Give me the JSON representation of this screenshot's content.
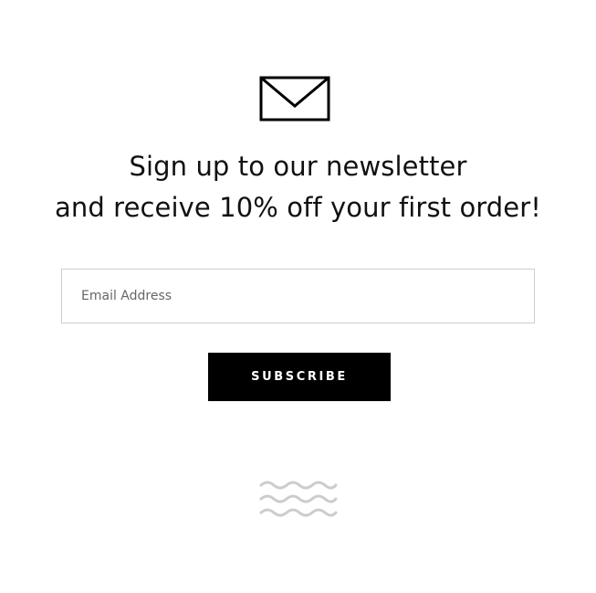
{
  "newsletter": {
    "icon": "envelope-icon",
    "headline_line1": "Sign up to our newsletter",
    "headline_line2": "and receive 10% off your first order!",
    "email_placeholder": "Email Address",
    "email_value": "",
    "subscribe_label": "SUBSCRIBE",
    "decoration_icon": "wave-lines-icon"
  },
  "colors": {
    "background": "#ffffff",
    "text": "#111111",
    "button_background": "#000000",
    "button_text": "#ffffff",
    "input_border": "#cfcfcf",
    "wave": "#cccccc"
  }
}
